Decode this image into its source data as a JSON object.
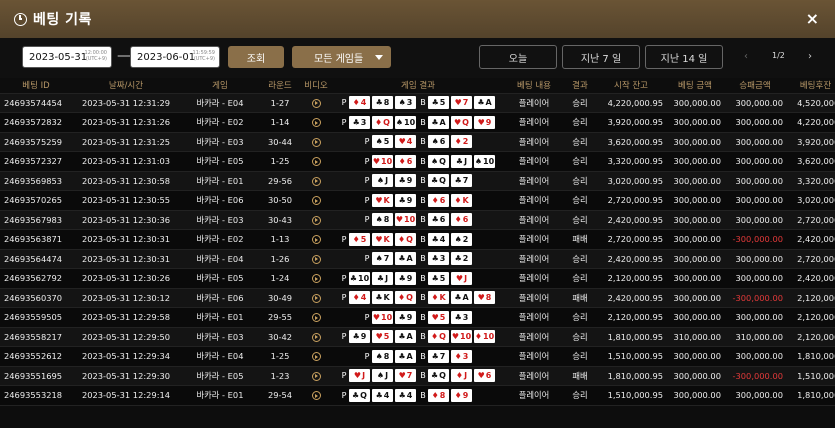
{
  "header": {
    "title": "베팅 기록",
    "close": "×"
  },
  "filter": {
    "start_date": "2023-05-31",
    "start_time": "12:00:00",
    "start_tz": "(UTC+9)",
    "end_date": "2023-06-01",
    "end_time": "11:59:59",
    "end_tz": "(UTC+9)",
    "dash": "—",
    "search_button": "조회",
    "game_select": "모든 게임들",
    "today_button": "오늘",
    "last7_button": "지난 7 일",
    "last14_button": "지난 14 일",
    "pager_prev": "‹",
    "pager_next": "›",
    "page_indicator": "1/2"
  },
  "columns": [
    "베팅 ID",
    "날짜/시간",
    "게임",
    "라운드",
    "비디오",
    "게임 결과",
    "베팅 내용",
    "결과",
    "시작 잔고",
    "베팅 금액",
    "승패금액",
    "베팅후잔"
  ],
  "icons": {
    "header": "clock-icon",
    "video": "play-icon",
    "close": "close-icon",
    "dropdown": "chevron-down-icon"
  },
  "colors": {
    "header_bg": "#5e4a30",
    "gold_text": "#b89868",
    "accent_button": "#8a6f49",
    "loss": "#e23a3a"
  },
  "rows": [
    {
      "id": "24693574454",
      "time": "2023-05-31 12:31:29",
      "game": "바카라 - E04",
      "round": "1-27",
      "p": [
        [
          "♦",
          "4"
        ],
        [
          "♣",
          "8"
        ],
        [
          "♠",
          "3"
        ]
      ],
      "b": [
        [
          "♣",
          "5"
        ],
        [
          "♥",
          "7"
        ],
        [
          "♣",
          "A"
        ]
      ],
      "bet": "플레이어",
      "result": "승리",
      "start": "4,220,000.95",
      "amount": "300,000.00",
      "winloss": "300,000.00",
      "after": "4,520,000."
    },
    {
      "id": "24693572832",
      "time": "2023-05-31 12:31:26",
      "game": "바카라 - E02",
      "round": "1-14",
      "p": [
        [
          "♣",
          "3"
        ],
        [
          "♦",
          "Q"
        ],
        [
          "♠",
          "10"
        ]
      ],
      "b": [
        [
          "♣",
          "A"
        ],
        [
          "♥",
          "Q"
        ],
        [
          "♥",
          "9"
        ]
      ],
      "bet": "플레이어",
      "result": "승리",
      "start": "3,920,000.95",
      "amount": "300,000.00",
      "winloss": "300,000.00",
      "after": "4,220,000."
    },
    {
      "id": "24693575259",
      "time": "2023-05-31 12:31:25",
      "game": "바카라 - E03",
      "round": "30-44",
      "p": [
        [
          "♠",
          "5"
        ],
        [
          "♥",
          "4"
        ]
      ],
      "b": [
        [
          "♠",
          "6"
        ],
        [
          "♦",
          "2"
        ]
      ],
      "bet": "플레이어",
      "result": "승리",
      "start": "3,620,000.95",
      "amount": "300,000.00",
      "winloss": "300,000.00",
      "after": "3,920,000."
    },
    {
      "id": "24693572327",
      "time": "2023-05-31 12:31:03",
      "game": "바카라 - E05",
      "round": "1-25",
      "p": [
        [
          "♥",
          "10"
        ],
        [
          "♦",
          "6"
        ]
      ],
      "b": [
        [
          "♠",
          "Q"
        ],
        [
          "♣",
          "J"
        ],
        [
          "♠",
          "10"
        ]
      ],
      "bet": "플레이어",
      "result": "승리",
      "start": "3,320,000.95",
      "amount": "300,000.00",
      "winloss": "300,000.00",
      "after": "3,620,000."
    },
    {
      "id": "24693569853",
      "time": "2023-05-31 12:30:58",
      "game": "바카라 - E01",
      "round": "29-56",
      "p": [
        [
          "♠",
          "J"
        ],
        [
          "♣",
          "9"
        ]
      ],
      "b": [
        [
          "♣",
          "Q"
        ],
        [
          "♣",
          "7"
        ]
      ],
      "bet": "플레이어",
      "result": "승리",
      "start": "3,020,000.95",
      "amount": "300,000.00",
      "winloss": "300,000.00",
      "after": "3,320,000."
    },
    {
      "id": "24693570265",
      "time": "2023-05-31 12:30:55",
      "game": "바카라 - E06",
      "round": "30-50",
      "p": [
        [
          "♥",
          "K"
        ],
        [
          "♣",
          "9"
        ]
      ],
      "b": [
        [
          "♦",
          "6"
        ],
        [
          "♦",
          "K"
        ]
      ],
      "bet": "플레이어",
      "result": "승리",
      "start": "2,720,000.95",
      "amount": "300,000.00",
      "winloss": "300,000.00",
      "after": "3,020,000."
    },
    {
      "id": "24693567983",
      "time": "2023-05-31 12:30:36",
      "game": "바카라 - E03",
      "round": "30-43",
      "p": [
        [
          "♠",
          "8"
        ],
        [
          "♥",
          "10"
        ]
      ],
      "b": [
        [
          "♣",
          "6"
        ],
        [
          "♦",
          "6"
        ]
      ],
      "bet": "플레이어",
      "result": "승리",
      "start": "2,420,000.95",
      "amount": "300,000.00",
      "winloss": "300,000.00",
      "after": "2,720,000."
    },
    {
      "id": "24693563871",
      "time": "2023-05-31 12:30:31",
      "game": "바카라 - E02",
      "round": "1-13",
      "p": [
        [
          "♦",
          "5"
        ],
        [
          "♥",
          "K"
        ],
        [
          "♦",
          "Q"
        ]
      ],
      "b": [
        [
          "♣",
          "4"
        ],
        [
          "♠",
          "2"
        ]
      ],
      "bet": "플레이어",
      "result": "패배",
      "start": "2,720,000.95",
      "amount": "300,000.00",
      "winloss": "-300,000.00",
      "after": "2,420,000."
    },
    {
      "id": "24693564474",
      "time": "2023-05-31 12:30:31",
      "game": "바카라 - E04",
      "round": "1-26",
      "p": [
        [
          "♠",
          "7"
        ],
        [
          "♣",
          "A"
        ]
      ],
      "b": [
        [
          "♣",
          "3"
        ],
        [
          "♣",
          "2"
        ]
      ],
      "bet": "플레이어",
      "result": "승리",
      "start": "2,420,000.95",
      "amount": "300,000.00",
      "winloss": "300,000.00",
      "after": "2,720,000."
    },
    {
      "id": "24693562792",
      "time": "2023-05-31 12:30:26",
      "game": "바카라 - E05",
      "round": "1-24",
      "p": [
        [
          "♣",
          "10"
        ],
        [
          "♣",
          "J"
        ],
        [
          "♣",
          "9"
        ]
      ],
      "b": [
        [
          "♣",
          "5"
        ],
        [
          "♥",
          "J"
        ]
      ],
      "bet": "플레이어",
      "result": "승리",
      "start": "2,120,000.95",
      "amount": "300,000.00",
      "winloss": "300,000.00",
      "after": "2,420,000."
    },
    {
      "id": "24693560370",
      "time": "2023-05-31 12:30:12",
      "game": "바카라 - E06",
      "round": "30-49",
      "p": [
        [
          "♦",
          "4"
        ],
        [
          "♣",
          "K"
        ],
        [
          "♦",
          "Q"
        ]
      ],
      "b": [
        [
          "♦",
          "K"
        ],
        [
          "♣",
          "A"
        ],
        [
          "♥",
          "8"
        ]
      ],
      "bet": "플레이어",
      "result": "패배",
      "start": "2,420,000.95",
      "amount": "300,000.00",
      "winloss": "-300,000.00",
      "after": "2,120,000."
    },
    {
      "id": "24693559505",
      "time": "2023-05-31 12:29:58",
      "game": "바카라 - E01",
      "round": "29-55",
      "p": [
        [
          "♥",
          "10"
        ],
        [
          "♣",
          "9"
        ]
      ],
      "b": [
        [
          "♥",
          "5"
        ],
        [
          "♣",
          "3"
        ]
      ],
      "bet": "플레이어",
      "result": "승리",
      "start": "2,120,000.95",
      "amount": "300,000.00",
      "winloss": "300,000.00",
      "after": "2,120,000."
    },
    {
      "id": "24693558217",
      "time": "2023-05-31 12:29:50",
      "game": "바카라 - E03",
      "round": "30-42",
      "p": [
        [
          "♣",
          "9"
        ],
        [
          "♥",
          "5"
        ],
        [
          "♣",
          "A"
        ]
      ],
      "b": [
        [
          "♦",
          "Q"
        ],
        [
          "♥",
          "10"
        ],
        [
          "♦",
          "10"
        ]
      ],
      "bet": "플레이어",
      "result": "승리",
      "start": "1,810,000.95",
      "amount": "310,000.00",
      "winloss": "310,000.00",
      "after": "2,120,000."
    },
    {
      "id": "24693552612",
      "time": "2023-05-31 12:29:34",
      "game": "바카라 - E04",
      "round": "1-25",
      "p": [
        [
          "♠",
          "8"
        ],
        [
          "♣",
          "A"
        ]
      ],
      "b": [
        [
          "♣",
          "7"
        ],
        [
          "♦",
          "3"
        ]
      ],
      "bet": "플레이어",
      "result": "승리",
      "start": "1,510,000.95",
      "amount": "300,000.00",
      "winloss": "300,000.00",
      "after": "1,810,000."
    },
    {
      "id": "24693551695",
      "time": "2023-05-31 12:29:30",
      "game": "바카라 - E05",
      "round": "1-23",
      "p": [
        [
          "♥",
          "J"
        ],
        [
          "♠",
          "J"
        ],
        [
          "♥",
          "7"
        ]
      ],
      "b": [
        [
          "♣",
          "Q"
        ],
        [
          "♦",
          "J"
        ],
        [
          "♥",
          "6"
        ]
      ],
      "bet": "플레이어",
      "result": "패배",
      "start": "1,810,000.95",
      "amount": "300,000.00",
      "winloss": "-300,000.00",
      "after": "1,510,000."
    },
    {
      "id": "24693553218",
      "time": "2023-05-31 12:29:14",
      "game": "바카라 - E01",
      "round": "29-54",
      "p": [
        [
          "♣",
          "Q"
        ],
        [
          "♣",
          "4"
        ],
        [
          "♣",
          "4"
        ]
      ],
      "b": [
        [
          "♦",
          "8"
        ],
        [
          "♦",
          "9"
        ]
      ],
      "bet": "플레이어",
      "result": "승리",
      "start": "1,510,000.95",
      "amount": "300,000.00",
      "winloss": "300,000.00",
      "after": "1,810,000."
    }
  ]
}
